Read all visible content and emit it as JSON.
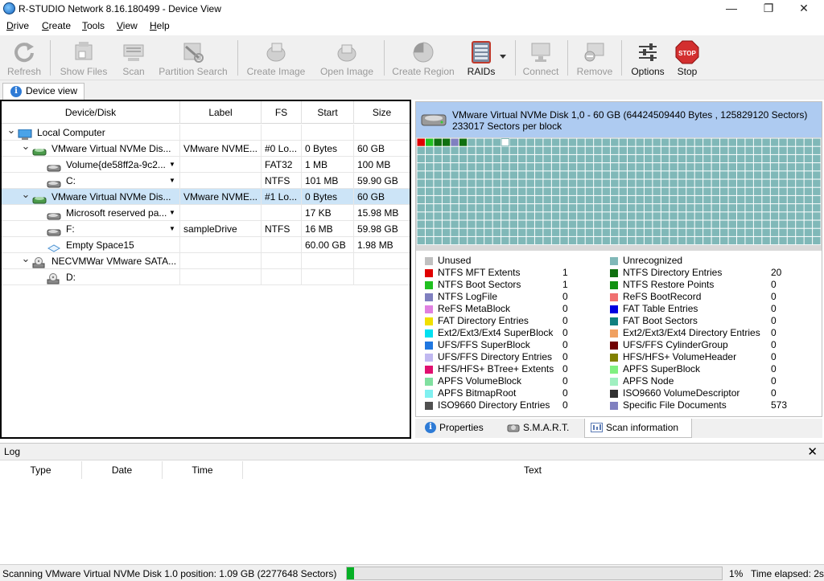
{
  "window": {
    "title": "R-STUDIO Network 8.16.180499 - Device View",
    "minimize": "—",
    "maximize": "❐",
    "close": "✕"
  },
  "menu": [
    {
      "label": "Drive",
      "key": "D"
    },
    {
      "label": "Create",
      "key": "C"
    },
    {
      "label": "Tools",
      "key": "T"
    },
    {
      "label": "View",
      "key": "V"
    },
    {
      "label": "Help",
      "key": "H"
    }
  ],
  "toolbar": {
    "refresh": "Refresh",
    "show_files": "Show Files",
    "scan": "Scan",
    "partition_search": "Partition Search",
    "create_image": "Create Image",
    "open_image": "Open Image",
    "create_region": "Create Region",
    "raids": "RAIDs",
    "connect": "Connect",
    "remove": "Remove",
    "options": "Options",
    "stop": "Stop",
    "stop_sign_text": "STOP"
  },
  "tabs": {
    "device_view": "Device view"
  },
  "grid": {
    "columns": [
      "Device/Disk",
      "Label",
      "FS",
      "Start",
      "Size"
    ],
    "rows": [
      {
        "name": "Local Computer",
        "label": "",
        "fs": "",
        "start": "",
        "size": "",
        "icon": "computer-icon"
      },
      {
        "name": "VMware Virtual NVMe Dis...",
        "label": "VMware NVME...",
        "fs": "#0 Lo...",
        "start": "0 Bytes",
        "size": "60 GB",
        "icon": "disk-icon"
      },
      {
        "name": "Volume{de58ff2a-9c2...",
        "label": "",
        "fs": "FAT32",
        "start": "1 MB",
        "size": "100 MB",
        "icon": "partition-icon"
      },
      {
        "name": "C:",
        "label": "",
        "fs": "NTFS",
        "start": "101 MB",
        "size": "59.90 GB",
        "icon": "partition-icon"
      },
      {
        "name": "VMware Virtual NVMe Dis...",
        "label": "VMware NVME...",
        "fs": "#1 Lo...",
        "start": "0 Bytes",
        "size": "60 GB",
        "icon": "disk-icon",
        "selected": true
      },
      {
        "name": "Microsoft reserved pa...",
        "label": "",
        "fs": "",
        "start": "17 KB",
        "size": "15.98 MB",
        "icon": "partition-icon"
      },
      {
        "name": "F:",
        "label": "sampleDrive",
        "fs": "NTFS",
        "start": "16 MB",
        "size": "59.98 GB",
        "icon": "partition-icon"
      },
      {
        "name": "Empty Space15",
        "label": "",
        "fs": "",
        "start": "60.00 GB",
        "size": "1.98 MB",
        "icon": "empty-space-icon"
      },
      {
        "name": "NECVMWar VMware SATA...",
        "label": "",
        "fs": "",
        "start": "",
        "size": "",
        "icon": "cdrom-icon"
      },
      {
        "name": "D:",
        "label": "",
        "fs": "",
        "start": "",
        "size": "",
        "icon": "cdrom-icon"
      }
    ]
  },
  "disk_panel": {
    "line1": "VMware Virtual NVMe Disk 1,0 - 60 GB (64424509440 Bytes , 125829120 Sectors)",
    "line2": "233017 Sectors per block"
  },
  "legend": {
    "left": [
      {
        "name": "Unused",
        "count": "",
        "color": "#c0c0c0"
      },
      {
        "name": "NTFS MFT Extents",
        "count": "1",
        "color": "#e00000"
      },
      {
        "name": "NTFS Boot Sectors",
        "count": "1",
        "color": "#20c020"
      },
      {
        "name": "NTFS LogFile",
        "count": "0",
        "color": "#7f7fbf"
      },
      {
        "name": "ReFS MetaBlock",
        "count": "0",
        "color": "#e080e0"
      },
      {
        "name": "FAT Directory Entries",
        "count": "0",
        "color": "#f0e000"
      },
      {
        "name": "Ext2/Ext3/Ext4 SuperBlock",
        "count": "0",
        "color": "#00e0f0"
      },
      {
        "name": "UFS/FFS SuperBlock",
        "count": "0",
        "color": "#1f77e0"
      },
      {
        "name": "UFS/FFS Directory Entries",
        "count": "0",
        "color": "#c0b8f0"
      },
      {
        "name": "HFS/HFS+ BTree+ Extents",
        "count": "0",
        "color": "#e0106f"
      },
      {
        "name": "APFS VolumeBlock",
        "count": "0",
        "color": "#80e0a0"
      },
      {
        "name": "APFS BitmapRoot",
        "count": "0",
        "color": "#80f0f0"
      },
      {
        "name": "ISO9660 Directory Entries",
        "count": "0",
        "color": "#505050"
      }
    ],
    "right": [
      {
        "name": "Unrecognized",
        "count": "",
        "color": "#80b8b8"
      },
      {
        "name": "NTFS Directory Entries",
        "count": "20",
        "color": "#107010"
      },
      {
        "name": "NTFS Restore Points",
        "count": "0",
        "color": "#109010"
      },
      {
        "name": "ReFS BootRecord",
        "count": "0",
        "color": "#f07070"
      },
      {
        "name": "FAT Table Entries",
        "count": "0",
        "color": "#0000e0"
      },
      {
        "name": "FAT Boot Sectors",
        "count": "0",
        "color": "#108080"
      },
      {
        "name": "Ext2/Ext3/Ext4 Directory Entries",
        "count": "0",
        "color": "#f0a060"
      },
      {
        "name": "UFS/FFS CylinderGroup",
        "count": "0",
        "color": "#700000"
      },
      {
        "name": "HFS/HFS+ VolumeHeader",
        "count": "0",
        "color": "#808000"
      },
      {
        "name": "APFS SuperBlock",
        "count": "0",
        "color": "#80f080"
      },
      {
        "name": "APFS Node",
        "count": "0",
        "color": "#a0f0c0"
      },
      {
        "name": "ISO9660 VolumeDescriptor",
        "count": "0",
        "color": "#303030"
      },
      {
        "name": "Specific File Documents",
        "count": "573",
        "color": "#8080c0"
      }
    ]
  },
  "right_tabs": {
    "properties": "Properties",
    "smart": "S.M.A.R.T.",
    "scan_info": "Scan information"
  },
  "log": {
    "title": "Log",
    "close": "✕",
    "columns": [
      "Type",
      "Date",
      "Time",
      "Text"
    ]
  },
  "status": {
    "text": "Scanning VMware Virtual NVMe Disk 1.0 position: 1.09 GB (2277648 Sectors)",
    "progress_percent": 1,
    "percent_label": "1%",
    "elapsed": "Time elapsed: 2s"
  },
  "colors": {
    "map_cell": "#80b8b8",
    "selection": "#cce4f7",
    "header_blue": "#aecbf1",
    "progress": "#06b025"
  }
}
